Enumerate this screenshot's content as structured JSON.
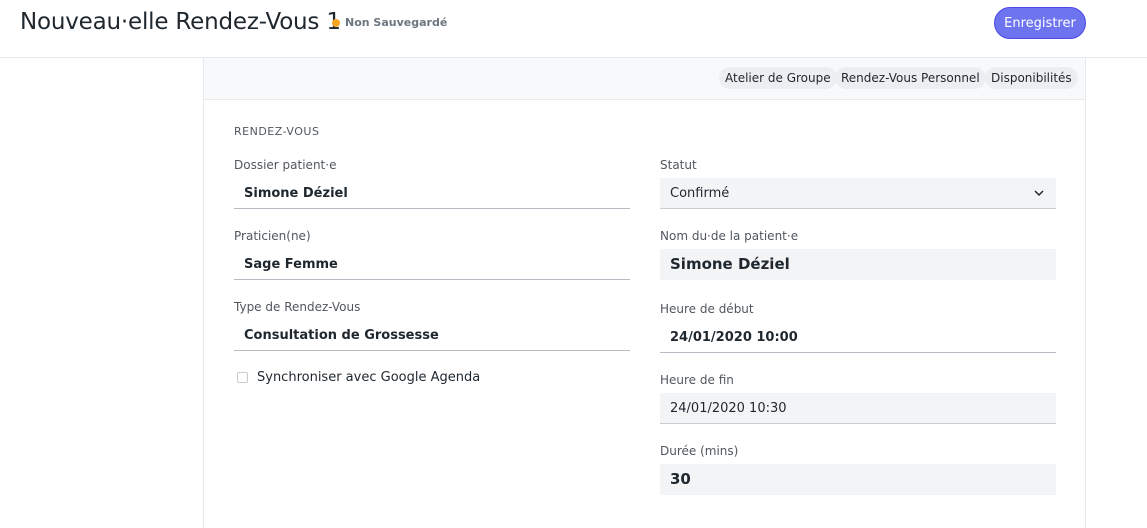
{
  "header": {
    "title": "Nouveau·elle Rendez-Vous 1",
    "status": "Non Sauvegardé",
    "save_label": "Enregistrer",
    "status_color": "#f5a623",
    "accent": "#6e74f0"
  },
  "toolbar": {
    "buttons": [
      "Atelier de Groupe",
      "Rendez-Vous Personnel",
      "Disponibilités"
    ]
  },
  "form": {
    "section_title": "RENDEZ-VOUS",
    "patient_label": "Dossier patient·e",
    "patient_value": "Simone Déziel",
    "practitioner_label": "Praticien(ne)",
    "practitioner_value": "Sage Femme",
    "type_label": "Type de Rendez-Vous",
    "type_value": "Consultation de Grossesse",
    "sync_label": "Synchroniser avec Google Agenda",
    "status_label": "Statut",
    "status_value": "Confirmé",
    "patient_name_label": "Nom du·de la patient·e",
    "patient_name_value": "Simone Déziel",
    "start_label": "Heure de début",
    "start_value": "24/01/2020 10:00",
    "end_label": "Heure de fin",
    "end_value": "24/01/2020 10:30",
    "duration_label": "Durée (mins)",
    "duration_value": "30"
  }
}
